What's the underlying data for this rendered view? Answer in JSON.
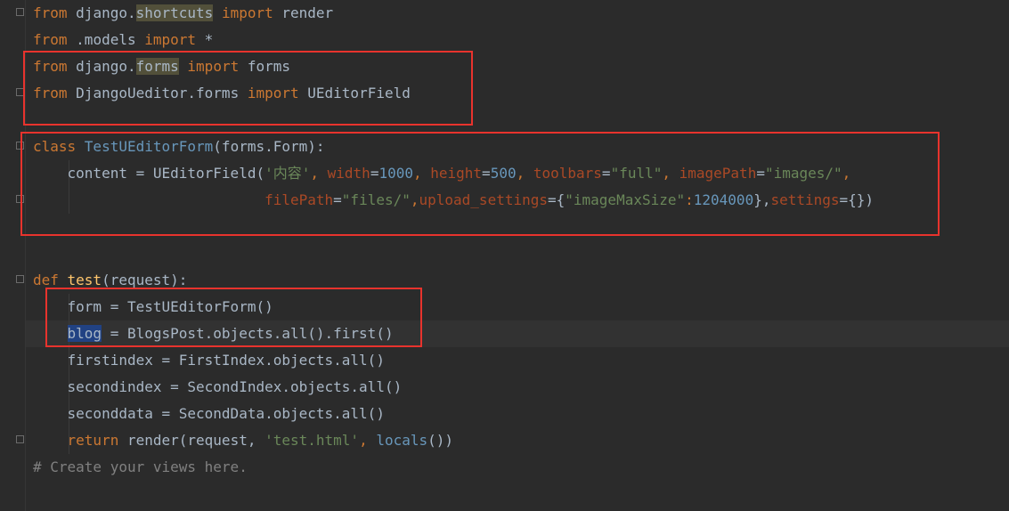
{
  "code_lines": [
    {
      "tokens": [
        {
          "t": "from ",
          "c": "kw"
        },
        {
          "t": "django.",
          "c": "cls"
        },
        {
          "t": "shortcuts",
          "c": "hl"
        },
        {
          "t": " import ",
          "c": "kw"
        },
        {
          "t": "render",
          "c": "cls"
        }
      ]
    },
    {
      "tokens": [
        {
          "t": "from ",
          "c": "kw"
        },
        {
          "t": ".models ",
          "c": "cls"
        },
        {
          "t": "import ",
          "c": "kw"
        },
        {
          "t": "*",
          "c": "cls"
        }
      ]
    },
    {
      "tokens": [
        {
          "t": "from ",
          "c": "kw"
        },
        {
          "t": "django.",
          "c": "cls"
        },
        {
          "t": "forms",
          "c": "hl"
        },
        {
          "t": " import ",
          "c": "kw"
        },
        {
          "t": "forms",
          "c": "cls"
        }
      ]
    },
    {
      "tokens": [
        {
          "t": "from ",
          "c": "kw"
        },
        {
          "t": "DjangoUeditor.forms ",
          "c": "cls"
        },
        {
          "t": "import ",
          "c": "kw"
        },
        {
          "t": "UEditorField",
          "c": "cls"
        }
      ]
    },
    {
      "tokens": []
    },
    {
      "tokens": [
        {
          "t": "class ",
          "c": "kw"
        },
        {
          "t": "TestUEditorForm",
          "c": "blue"
        },
        {
          "t": "(forms.Form):",
          "c": "cls"
        }
      ]
    },
    {
      "tokens": [
        {
          "t": "    content = UEditorField(",
          "c": "cls"
        },
        {
          "t": "'内容'",
          "c": "str"
        },
        {
          "t": ", ",
          "c": "kw"
        },
        {
          "t": "width",
          "c": "prm"
        },
        {
          "t": "=",
          "c": "cls"
        },
        {
          "t": "1000",
          "c": "num"
        },
        {
          "t": ", ",
          "c": "kw"
        },
        {
          "t": "height",
          "c": "prm"
        },
        {
          "t": "=",
          "c": "cls"
        },
        {
          "t": "500",
          "c": "num"
        },
        {
          "t": ", ",
          "c": "kw"
        },
        {
          "t": "toolbars",
          "c": "prm"
        },
        {
          "t": "=",
          "c": "cls"
        },
        {
          "t": "\"full\"",
          "c": "str"
        },
        {
          "t": ", ",
          "c": "kw"
        },
        {
          "t": "imagePath",
          "c": "prm"
        },
        {
          "t": "=",
          "c": "cls"
        },
        {
          "t": "\"images/\"",
          "c": "str"
        },
        {
          "t": ",",
          "c": "kw"
        }
      ]
    },
    {
      "tokens": [
        {
          "t": "                           ",
          "c": "cls"
        },
        {
          "t": "filePath",
          "c": "prm"
        },
        {
          "t": "=",
          "c": "cls"
        },
        {
          "t": "\"files/\"",
          "c": "str"
        },
        {
          "t": ",",
          "c": "kw"
        },
        {
          "t": "upload_settings",
          "c": "prm"
        },
        {
          "t": "={",
          "c": "cls"
        },
        {
          "t": "\"imageMaxSize\"",
          "c": "str"
        },
        {
          "t": ":",
          "c": "kw"
        },
        {
          "t": "1204000",
          "c": "num"
        },
        {
          "t": "},",
          "c": "cls"
        },
        {
          "t": "settings",
          "c": "prm"
        },
        {
          "t": "={})",
          "c": "cls"
        }
      ]
    },
    {
      "tokens": []
    },
    {
      "tokens": []
    },
    {
      "tokens": [
        {
          "t": "def ",
          "c": "kw"
        },
        {
          "t": "test",
          "c": "def"
        },
        {
          "t": "(request):",
          "c": "cls"
        }
      ]
    },
    {
      "tokens": [
        {
          "t": "    form = TestUEditorForm()",
          "c": "cls"
        }
      ]
    },
    {
      "tokens": [
        {
          "t": "    ",
          "c": "cls"
        },
        {
          "t": "blog",
          "c": "sel"
        },
        {
          "t": " = BlogsPost.objects.all().first()",
          "c": "cls"
        }
      ]
    },
    {
      "tokens": [
        {
          "t": "    firstindex = FirstIndex.objects.all()",
          "c": "cls"
        }
      ]
    },
    {
      "tokens": [
        {
          "t": "    secondindex = SecondIndex.objects.all()",
          "c": "cls"
        }
      ]
    },
    {
      "tokens": [
        {
          "t": "    seconddata = SecondData.objects.all()",
          "c": "cls"
        }
      ]
    },
    {
      "tokens": [
        {
          "t": "    ",
          "c": "cls"
        },
        {
          "t": "return ",
          "c": "kw"
        },
        {
          "t": "render(request, ",
          "c": "cls"
        },
        {
          "t": "'test.html'",
          "c": "str"
        },
        {
          "t": ", ",
          "c": "kw"
        },
        {
          "t": "locals",
          "c": "blue"
        },
        {
          "t": "())",
          "c": "cls"
        }
      ]
    },
    {
      "tokens": [
        {
          "t": "# Create your views here.",
          "c": "cmt"
        }
      ]
    }
  ]
}
